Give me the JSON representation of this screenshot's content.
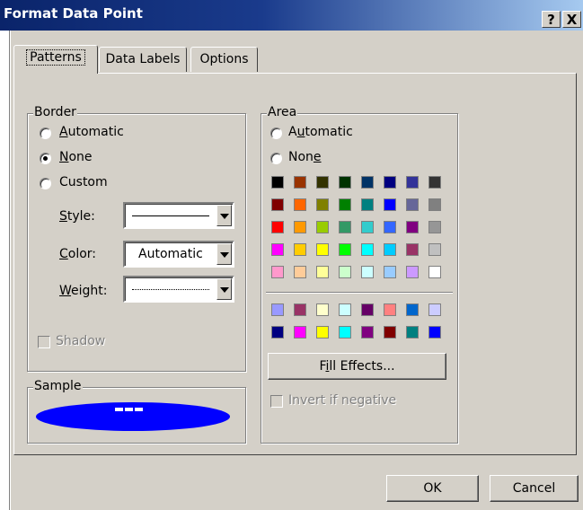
{
  "window": {
    "title": "Format Data Point",
    "help_label": "?",
    "close_label": "X"
  },
  "tabs": [
    {
      "label": "Patterns",
      "selected": true
    },
    {
      "label": "Data Labels",
      "selected": false
    },
    {
      "label": "Options",
      "selected": false
    }
  ],
  "border": {
    "legend": "Border",
    "options": [
      {
        "pre": "",
        "accel": "A",
        "post": "utomatic",
        "selected": false
      },
      {
        "pre": "",
        "accel": "N",
        "post": "one",
        "selected": true
      },
      {
        "pre": "Custom",
        "accel": "",
        "post": "",
        "selected": false
      }
    ],
    "style_label": {
      "pre": "",
      "accel": "S",
      "post": "tyle:"
    },
    "color_label": {
      "pre": "",
      "accel": "C",
      "post": "olor:"
    },
    "weight_label": {
      "pre": "",
      "accel": "W",
      "post": "eight:"
    },
    "color_value": "Automatic",
    "shadow_label": "Shadow"
  },
  "sample": {
    "legend": "Sample"
  },
  "area": {
    "legend": "Area",
    "options": [
      {
        "pre": "A",
        "accel": "u",
        "post": "tomatic",
        "selected": false
      },
      {
        "pre": "Non",
        "accel": "e",
        "post": "",
        "selected": false
      }
    ],
    "palette_main": [
      [
        "#000000",
        "#993300",
        "#333300",
        "#003300",
        "#003366",
        "#000080",
        "#333399",
        "#333333"
      ],
      [
        "#800000",
        "#FF6600",
        "#808000",
        "#008000",
        "#008080",
        "#0000FF",
        "#666699",
        "#808080"
      ],
      [
        "#FF0000",
        "#FF9900",
        "#99CC00",
        "#339966",
        "#33CCCC",
        "#3366FF",
        "#800080",
        "#969696"
      ],
      [
        "#FF00FF",
        "#FFCC00",
        "#FFFF00",
        "#00FF00",
        "#00FFFF",
        "#00CCFF",
        "#993366",
        "#C0C0C0"
      ],
      [
        "#FF99CC",
        "#FFCC99",
        "#FFFF99",
        "#CCFFCC",
        "#CCFFFF",
        "#99CCFF",
        "#CC99FF",
        "#FFFFFF"
      ]
    ],
    "palette_chart": [
      [
        "#9999FF",
        "#993366",
        "#FFFFCC",
        "#CCFFFF",
        "#660066",
        "#FF8080",
        "#0066CC",
        "#CCCCFF"
      ],
      [
        "#000080",
        "#FF00FF",
        "#FFFF00",
        "#00FFFF",
        "#800080",
        "#800000",
        "#008080",
        "#0000FF"
      ]
    ],
    "fill_effects": {
      "pre": "F",
      "accel": "i",
      "post": "ll Effects..."
    },
    "invert_label": "Invert if negative"
  },
  "footer": {
    "ok_label": "OK",
    "cancel_label": "Cancel"
  },
  "colors": {
    "title_start": "#0a246a",
    "title_end": "#a6caf0",
    "dialog_bg": "#d4d0c8",
    "sample_fill": "#0000FF"
  }
}
